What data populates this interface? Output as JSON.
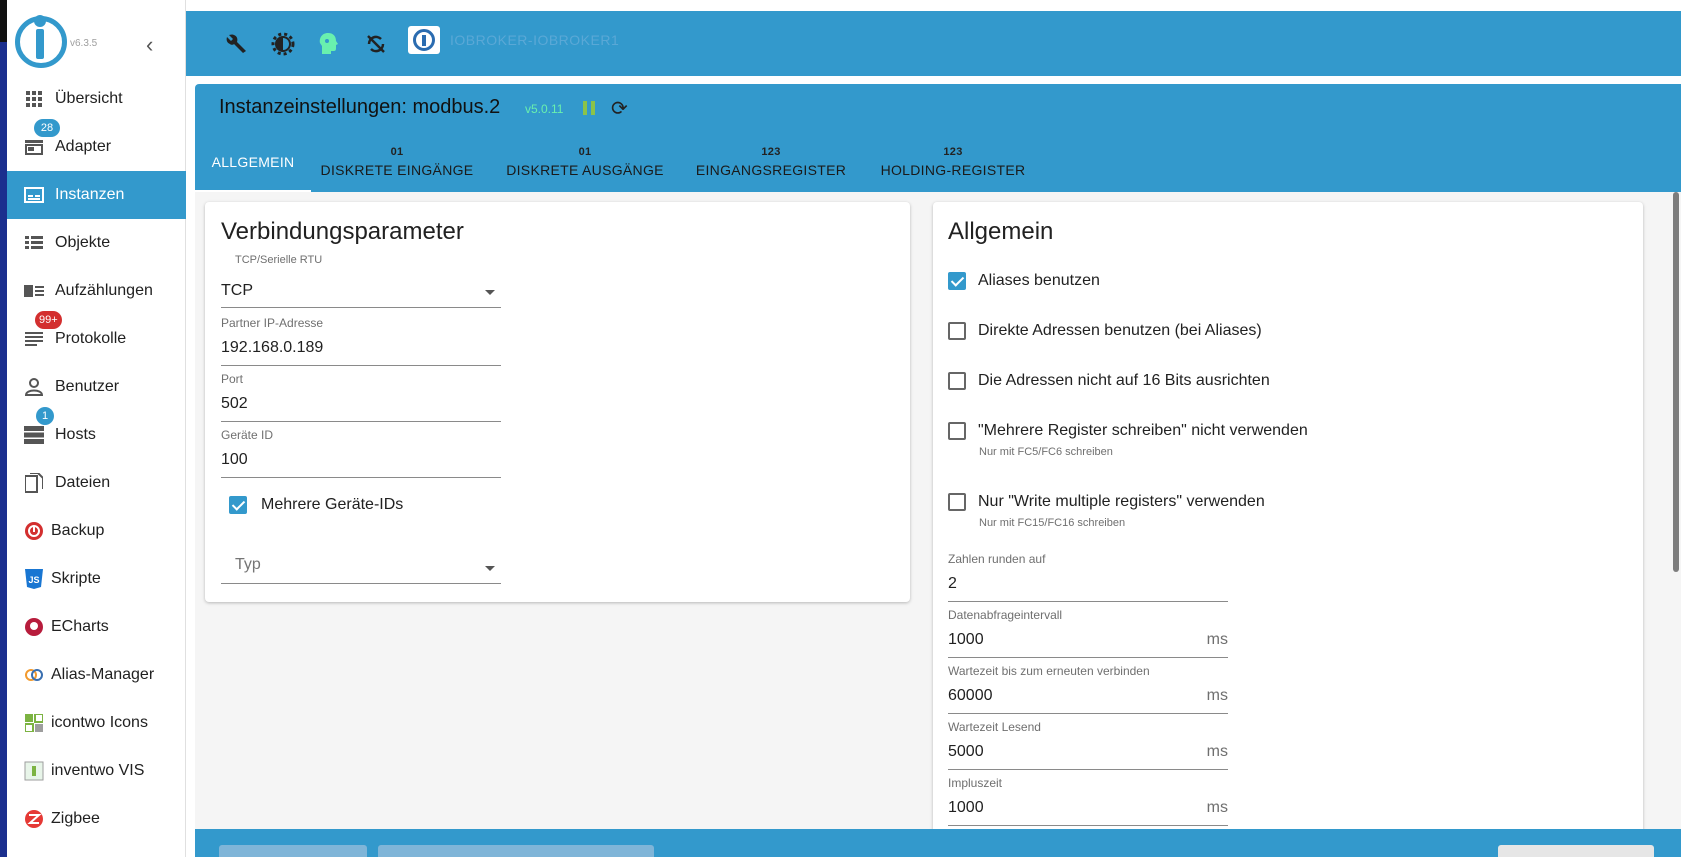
{
  "app": {
    "version": "v6.3.5",
    "host_name": "IOBROKER-IOBROKER1",
    "accent_color": "#3399cc"
  },
  "sidebar": {
    "items": [
      {
        "label": "Übersicht",
        "icon": "apps-grid-icon"
      },
      {
        "label": "Adapter",
        "icon": "store-icon",
        "badge": "28"
      },
      {
        "label": "Instanzen",
        "icon": "instances-icon",
        "active": true
      },
      {
        "label": "Objekte",
        "icon": "list-icon"
      },
      {
        "label": "Aufzählungen",
        "icon": "enum-icon"
      },
      {
        "label": "Protokolle",
        "icon": "log-icon",
        "badge": "99+"
      },
      {
        "label": "Benutzer",
        "icon": "user-icon"
      },
      {
        "label": "Hosts",
        "icon": "hosts-icon",
        "badge": "1"
      },
      {
        "label": "Dateien",
        "icon": "files-icon"
      },
      {
        "label": "Backup",
        "icon": "backup-icon"
      },
      {
        "label": "Skripte",
        "icon": "javascript-icon"
      },
      {
        "label": "ECharts",
        "icon": "echarts-icon"
      },
      {
        "label": "Alias-Manager",
        "icon": "alias-icon"
      },
      {
        "label": "icontwo Icons",
        "icon": "icontwo-icon"
      },
      {
        "label": "inventwo VIS",
        "icon": "inventwo-icon"
      },
      {
        "label": "Zigbee",
        "icon": "zigbee-icon"
      }
    ]
  },
  "instance": {
    "title": "Instanzeinstellungen: modbus.2",
    "version": "v5.0.11"
  },
  "tabs": [
    {
      "label": "ALLGEMEIN",
      "sup": "",
      "active": true
    },
    {
      "label": "DISKRETE EINGÄNGE",
      "sup": "01"
    },
    {
      "label": "DISKRETE AUSGÄNGE",
      "sup": "01"
    },
    {
      "label": "EINGANGSREGISTER",
      "sup": "123"
    },
    {
      "label": "HOLDING-REGISTER",
      "sup": "123"
    }
  ],
  "connection": {
    "title": "Verbindungsparameter",
    "type_label": "TCP/Serielle RTU",
    "type_value": "TCP",
    "ip_label": "Partner IP-Adresse",
    "ip_value": "192.168.0.189",
    "port_label": "Port",
    "port_value": "502",
    "device_label": "Geräte ID",
    "device_value": "100",
    "multi_ids_label": "Mehrere Geräte-IDs",
    "multi_ids_checked": true,
    "typ_placeholder": "Typ"
  },
  "general": {
    "title": "Allgemein",
    "checkboxes": [
      {
        "label": "Aliases benutzen",
        "checked": true,
        "hint": ""
      },
      {
        "label": "Direkte Adressen benutzen (bei Aliases)",
        "checked": false,
        "hint": ""
      },
      {
        "label": "Die Adressen nicht auf 16 Bits ausrichten",
        "checked": false,
        "hint": ""
      },
      {
        "label": "\"Mehrere Register schreiben\" nicht verwenden",
        "checked": false,
        "hint": "Nur mit FC5/FC6 schreiben"
      },
      {
        "label": "Nur \"Write multiple registers\" verwenden",
        "checked": false,
        "hint": "Nur mit FC15/FC16 schreiben"
      }
    ],
    "fields": [
      {
        "label": "Zahlen runden auf",
        "value": "2",
        "unit": ""
      },
      {
        "label": "Datenabfrageintervall",
        "value": "1000",
        "unit": "ms"
      },
      {
        "label": "Wartezeit bis zum erneuten verbinden",
        "value": "60000",
        "unit": "ms"
      },
      {
        "label": "Wartezeit Lesend",
        "value": "5000",
        "unit": "ms"
      },
      {
        "label": "Impluszeit",
        "value": "1000",
        "unit": "ms"
      }
    ]
  }
}
